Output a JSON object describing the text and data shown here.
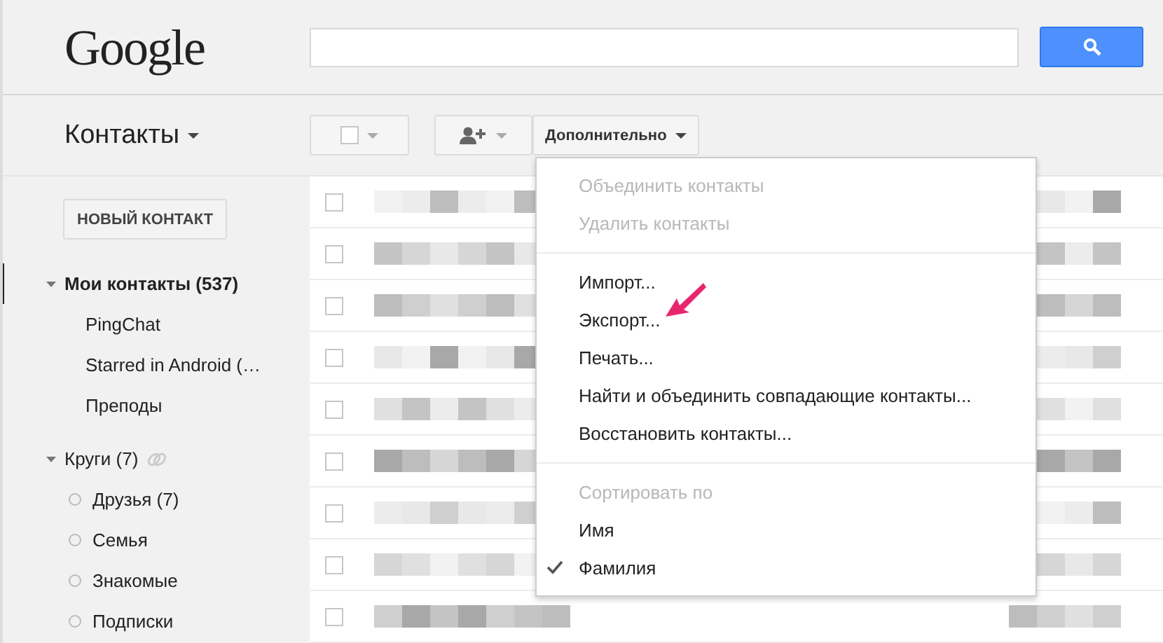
{
  "header": {
    "logo": "Google"
  },
  "toolbar": {
    "title": "Контакты",
    "more_button": "Дополнительно"
  },
  "sidebar": {
    "new_contact_button": "НОВЫЙ КОНТАКТ",
    "groups": [
      {
        "label": "Мои контакты (537)",
        "expanded": true,
        "selected": true,
        "kind": "group",
        "children": [
          {
            "label": "PingChat"
          },
          {
            "label": "Starred in Android (…"
          },
          {
            "label": "Преподы"
          }
        ]
      },
      {
        "label": "Круги (7)",
        "expanded": true,
        "selected": false,
        "kind": "circles",
        "children": [
          {
            "label": "Друзья (7)"
          },
          {
            "label": "Семья"
          },
          {
            "label": "Знакомые"
          },
          {
            "label": "Подписки"
          }
        ]
      }
    ]
  },
  "rows": [
    {
      "checked": false
    },
    {
      "checked": false
    },
    {
      "checked": false
    },
    {
      "checked": false
    },
    {
      "checked": false
    },
    {
      "checked": false
    },
    {
      "checked": false
    },
    {
      "checked": false
    },
    {
      "checked": false
    }
  ],
  "menu": {
    "sections": [
      [
        {
          "label": "Объединить контакты",
          "disabled": true,
          "checked": false
        },
        {
          "label": "Удалить контакты",
          "disabled": true,
          "checked": false
        }
      ],
      [
        {
          "label": "Импорт...",
          "disabled": false,
          "checked": false
        },
        {
          "label": "Экспорт...",
          "disabled": false,
          "checked": false
        },
        {
          "label": "Печать...",
          "disabled": false,
          "checked": false
        },
        {
          "label": "Найти и объединить совпадающие контакты...",
          "disabled": false,
          "checked": false
        },
        {
          "label": "Восстановить контакты...",
          "disabled": false,
          "checked": false
        }
      ],
      [
        {
          "label": "Сортировать по",
          "disabled": true,
          "checked": false
        },
        {
          "label": "Имя",
          "disabled": false,
          "checked": false
        },
        {
          "label": "Фамилия",
          "disabled": false,
          "checked": true
        }
      ]
    ]
  }
}
